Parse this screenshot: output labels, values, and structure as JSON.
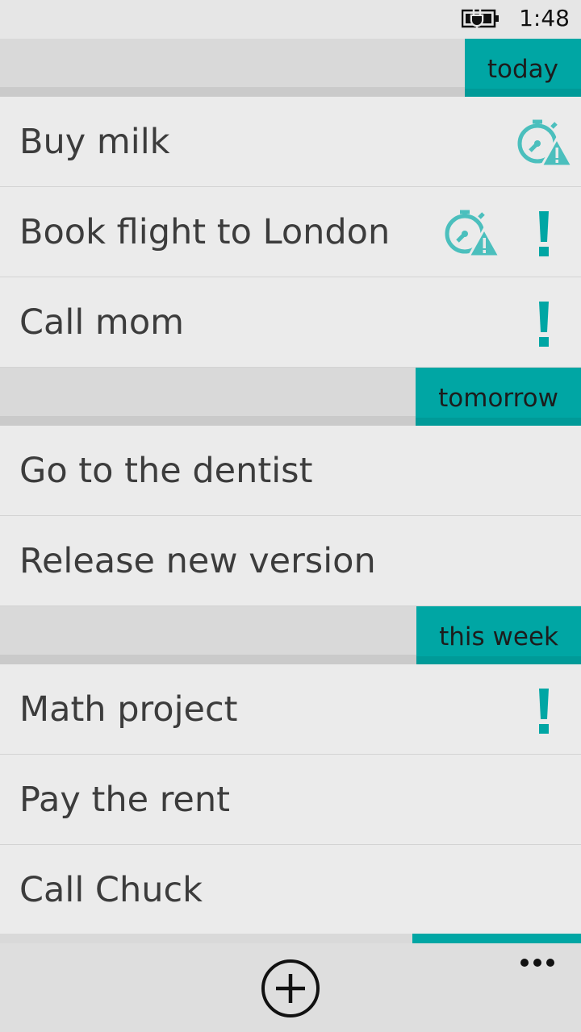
{
  "status_bar": {
    "time": "1:48",
    "battery_icon": "battery-charging-icon"
  },
  "groups": [
    {
      "label": "today",
      "tasks": [
        {
          "title": "Buy milk",
          "overdue_alarm": true,
          "priority": false
        },
        {
          "title": "Book flight to London",
          "overdue_alarm": true,
          "priority": true
        },
        {
          "title": "Call mom",
          "overdue_alarm": false,
          "priority": true
        }
      ]
    },
    {
      "label": "tomorrow",
      "tasks": [
        {
          "title": "Go to the dentist",
          "overdue_alarm": false,
          "priority": false
        },
        {
          "title": "Release new version",
          "overdue_alarm": false,
          "priority": false
        }
      ]
    },
    {
      "label": "this week",
      "tasks": [
        {
          "title": "Math project",
          "overdue_alarm": false,
          "priority": true
        },
        {
          "title": "Pay the rent",
          "overdue_alarm": false,
          "priority": false
        },
        {
          "title": "Call Chuck",
          "overdue_alarm": false,
          "priority": false
        }
      ]
    }
  ],
  "icons": {
    "alarm": "overdue-alarm-icon",
    "priority": "priority-icon",
    "add": "add-icon",
    "more": "more-icon"
  },
  "colors": {
    "accent": "#00a6a4",
    "background": "#ebebeb",
    "header": "#d9d9d9",
    "text": "#3c3c3c"
  }
}
